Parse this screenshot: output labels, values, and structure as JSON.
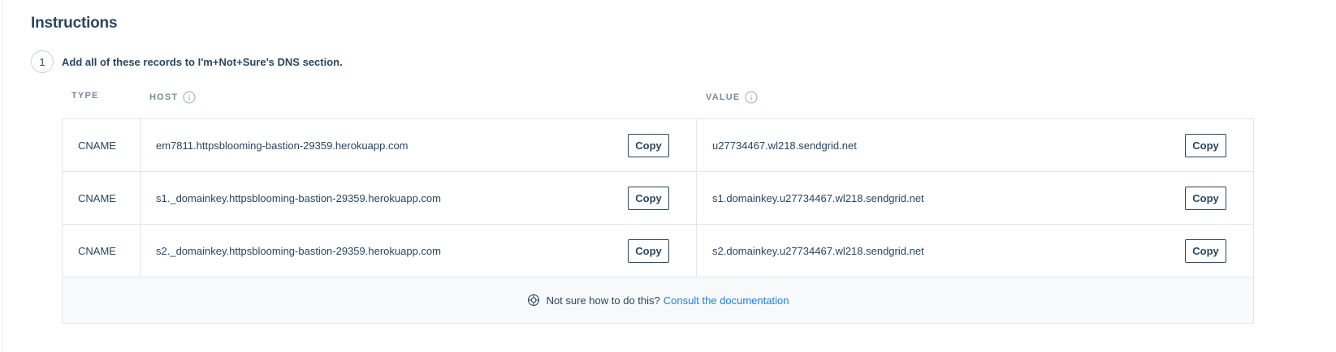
{
  "title": "Instructions",
  "step": {
    "number": "1",
    "text": "Add all of these records to I'm+Not+Sure's DNS section."
  },
  "columns": {
    "type": "TYPE",
    "host": "HOST",
    "value": "VALUE"
  },
  "records": [
    {
      "type": "CNAME",
      "host": "em7811.httpsblooming-bastion-29359.herokuapp.com",
      "host_copy": "Copy",
      "value": "u27734467.wl218.sendgrid.net",
      "value_copy": "Copy"
    },
    {
      "type": "CNAME",
      "host": "s1._domainkey.httpsblooming-bastion-29359.herokuapp.com",
      "host_copy": "Copy",
      "value": "s1.domainkey.u27734467.wl218.sendgrid.net",
      "value_copy": "Copy"
    },
    {
      "type": "CNAME",
      "host": "s2._domainkey.httpsblooming-bastion-29359.herokuapp.com",
      "host_copy": "Copy",
      "value": "s2.domainkey.u27734467.wl218.sendgrid.net",
      "value_copy": "Copy"
    }
  ],
  "help": {
    "text": "Not sure how to do this?",
    "link": "Consult the documentation"
  },
  "icons": {
    "info": "info-icon",
    "help": "lifebuoy-icon"
  },
  "colors": {
    "text": "#294661",
    "muted": "#7a8a99",
    "link": "#1a82e2",
    "border": "#e0e5ea",
    "help_bg": "#f8f9fa"
  }
}
